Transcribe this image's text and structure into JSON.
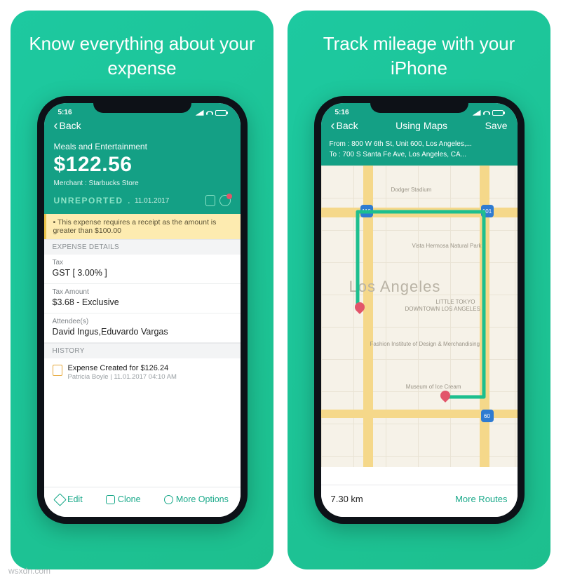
{
  "panels": {
    "left_title": "Know everything about your expense",
    "right_title": "Track mileage with your iPhone"
  },
  "status": {
    "time": "5:16"
  },
  "nav_left": {
    "back": "Back"
  },
  "nav_right": {
    "back": "Back",
    "title": "Using Maps",
    "save": "Save"
  },
  "expense": {
    "category": "Meals and Entertainment",
    "amount": "$122.56",
    "merchant": "Merchant : Starbucks Store",
    "status": "UNREPORTED",
    "status_date": "11.01.2017",
    "notice": "• This expense requires a receipt as the amount is greater than $100.00",
    "sections": {
      "details_title": "EXPENSE DETAILS",
      "tax_label": "Tax",
      "tax_value": "GST [ 3.00% ]",
      "tax_amount_label": "Tax Amount",
      "tax_amount_value": "$3.68 - Exclusive",
      "attendees_label": "Attendee(s)",
      "attendees_value": "David Ingus,Eduvardo Vargas",
      "history_title": "HISTORY",
      "history_line": "Expense Created for $126.24",
      "history_sub": "Patricia Boyle | 11.01.2017 04:10 AM"
    }
  },
  "toolbar": {
    "edit": "Edit",
    "clone": "Clone",
    "more": "More Options"
  },
  "trip": {
    "from": "From : 800 W 6th St, Unit 600, Los Angeles,...",
    "to": "To     : 700 S Santa Fe Ave, Los Angeles, CA...",
    "city_label": "Los Angeles",
    "places": [
      "Dodger Stadium",
      "Vista Hermosa Natural Park",
      "DOWNTOWN LOS ANGELES",
      "Fashion Institute of Design & Merchandising",
      "Museum of Ice Cream",
      "LITTLE TOKYO"
    ],
    "hwy": [
      "110",
      "101",
      "60"
    ]
  },
  "map_footer": {
    "distance": "7.30 km",
    "more": "More Routes"
  },
  "watermark": "wsxdn.com"
}
